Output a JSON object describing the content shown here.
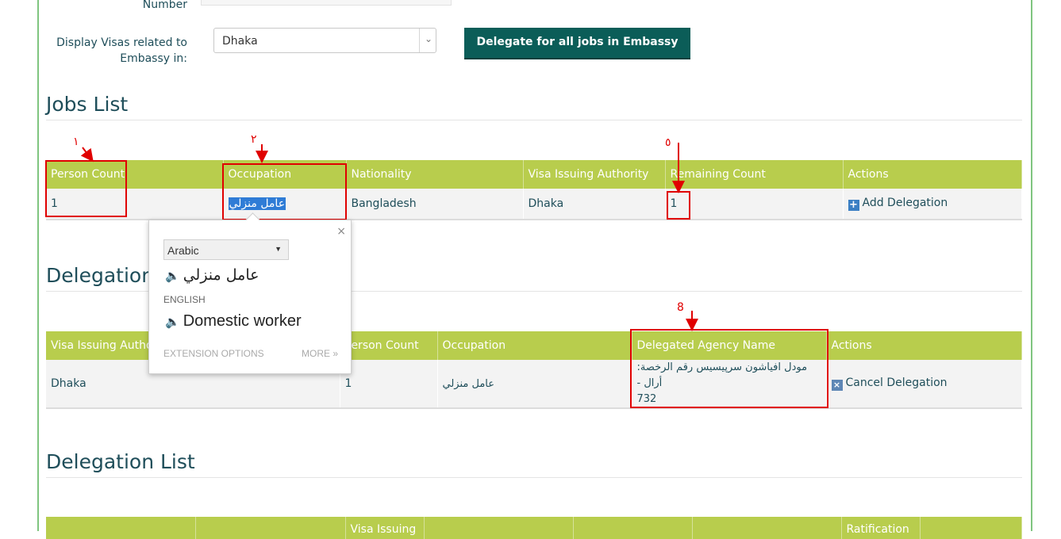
{
  "form": {
    "number_label": "Number",
    "display_label": "Display Visas related to Embassy in:",
    "embassy_selected": "Dhaka",
    "delegate_all_button": "Delegate for all jobs in Embassy"
  },
  "jobs_list": {
    "title": "Jobs List",
    "headers": [
      "Person Count",
      "Occupation",
      "Nationality",
      "Visa Issuing Authority",
      "Remaining Count",
      "Actions"
    ],
    "rows": [
      {
        "person_count": "1",
        "occupation": "عامل منزلي",
        "nationality": "Bangladesh",
        "authority": "Dhaka",
        "remaining": "1",
        "action": "Add Delegation"
      }
    ]
  },
  "delegations": {
    "title": "Delegations",
    "headers": [
      "Visa Issuing Author",
      "Person Count",
      "Occupation",
      "Delegated Agency Name",
      "Actions"
    ],
    "rows": [
      {
        "authority": "Dhaka",
        "person_count": "1",
        "occupation": "عامل منزلي",
        "agency": "مودل افياشون سرپيسيس رقم الرخصة: أرال -",
        "agency_license": "732",
        "action": "Cancel Delegation"
      }
    ]
  },
  "delegation_list": {
    "title": "Delegation List",
    "headers": [
      "",
      "",
      "Visa Issuing",
      "",
      "",
      "",
      "Ratification",
      ""
    ]
  },
  "annotations": {
    "a1": "١",
    "a2": "٢",
    "a3": "٥",
    "a4": "8"
  },
  "translate_popup": {
    "source_language": "Arabic",
    "source_text": "عامل منزلي",
    "target_label": "ENGLISH",
    "target_text": "Domestic worker",
    "extension_options": "EXTENSION OPTIONS",
    "more": "MORE »",
    "close": "×"
  },
  "colors": {
    "header_bg": "#b8cd4d",
    "button_bg": "#0b5d58",
    "annotation": "#e00000",
    "frame": "#7fc57f"
  }
}
